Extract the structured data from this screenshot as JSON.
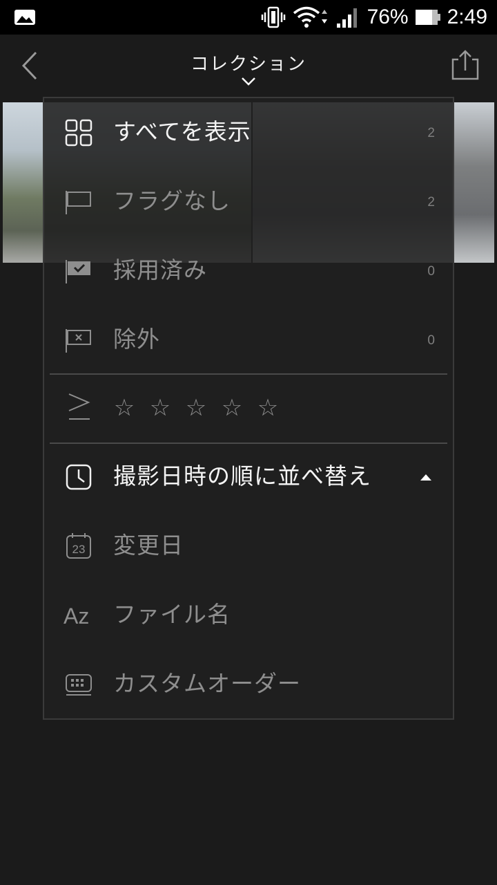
{
  "status_bar": {
    "battery_percent": "76%",
    "time": "2:49"
  },
  "app_bar": {
    "title": "コレクション"
  },
  "filter": {
    "items": [
      {
        "label": "すべてを表示",
        "count": "2",
        "icon": "grid-icon",
        "active": true
      },
      {
        "label": "フラグなし",
        "count": "2",
        "icon": "flag-outline-icon",
        "active": false
      },
      {
        "label": "採用済み",
        "count": "0",
        "icon": "flag-check-icon",
        "active": false
      },
      {
        "label": "除外",
        "count": "0",
        "icon": "flag-x-icon",
        "active": false
      }
    ],
    "rating_symbol": "≥",
    "stars": [
      "☆",
      "☆",
      "☆",
      "☆",
      "☆"
    ]
  },
  "sort": {
    "items": [
      {
        "label": "撮影日時の順に並べ替え",
        "icon": "clock-icon",
        "active": true
      },
      {
        "label": "変更日",
        "icon": "calendar-icon",
        "active": false
      },
      {
        "label": "ファイル名",
        "icon": "az-icon",
        "active": false
      },
      {
        "label": "カスタムオーダー",
        "icon": "keypad-icon",
        "active": false
      }
    ],
    "calendar_day": "23",
    "az_text": "Az"
  },
  "colors": {
    "background": "#1b1b1b",
    "panel": "#202020",
    "active_text": "#f4f4f4",
    "inactive_text": "#8e8e8e"
  }
}
